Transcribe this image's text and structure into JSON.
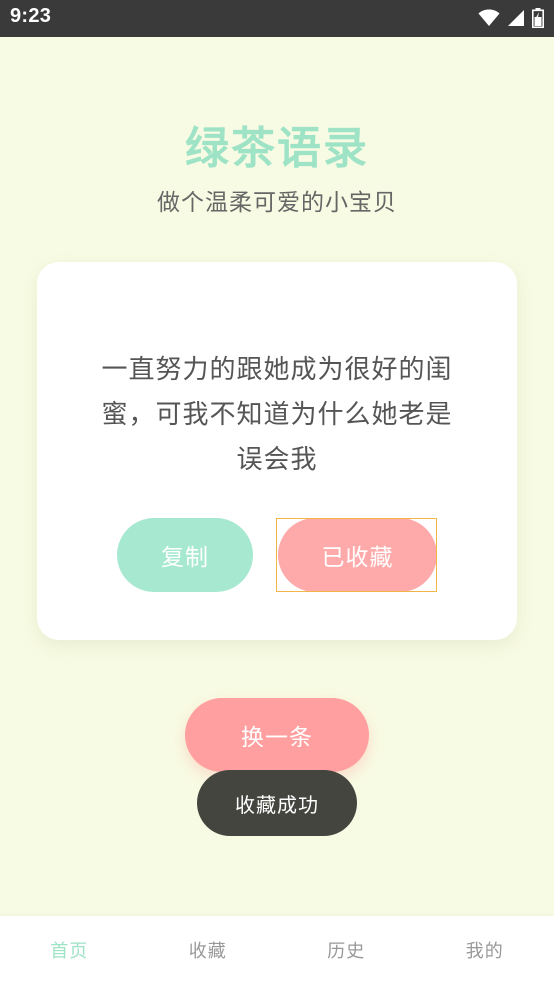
{
  "status_bar": {
    "time": "9:23",
    "icons": [
      "wifi-icon",
      "signal-icon",
      "battery-icon"
    ]
  },
  "header": {
    "title": "绿茶语录",
    "subtitle": "做个温柔可爱的小宝贝"
  },
  "card": {
    "quote": "一直努力的跟她成为很好的闺蜜，可我不知道为什么她老是误会我",
    "copy_label": "复制",
    "favorite_label": "已收藏"
  },
  "actions": {
    "next_label": "换一条"
  },
  "toast": {
    "message": "收藏成功"
  },
  "bottom_nav": {
    "items": [
      {
        "label": "首页",
        "active": true
      },
      {
        "label": "收藏",
        "active": false
      },
      {
        "label": "历史",
        "active": false
      },
      {
        "label": "我的",
        "active": false
      }
    ]
  },
  "colors": {
    "background": "#f8fbe3",
    "accent_green": "#9ee3c6",
    "copy_button": "#a7e8d1",
    "favorite_button": "#ffaaaa",
    "next_button": "#ff9f9f",
    "toast_bg": "#454540",
    "focus_outline": "#f2b54a"
  }
}
